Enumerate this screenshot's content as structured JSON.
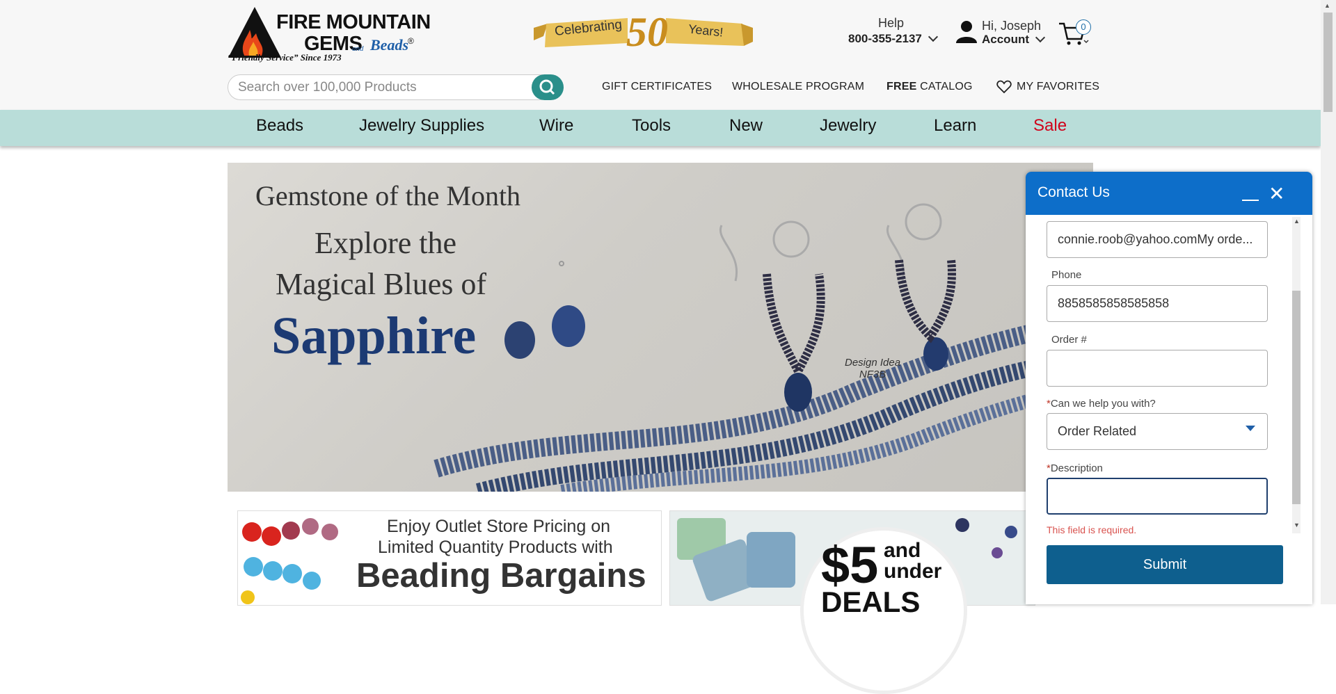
{
  "header": {
    "logo": {
      "line1": "FIRE MOUNTAIN",
      "line2": "GEMS",
      "and": "and",
      "beads": "Beads",
      "reg": "®",
      "tagline": "“Friendly Service” Since 1973"
    },
    "celebrating": {
      "text": "Celebrating",
      "number": "50",
      "years": "Years!"
    },
    "help_label": "Help",
    "phone": "800-355-2137",
    "greeting": "Hi, Joseph",
    "account_label": "Account",
    "cart_count": "0",
    "search_placeholder": "Search over 100,000 Products",
    "links": {
      "gift": "GIFT CERTIFICATES",
      "wholesale": "WHOLESALE PROGRAM",
      "free": "FREE",
      "catalog": "CATALOG",
      "favorites": "MY FAVORITES"
    }
  },
  "menu": [
    "Beads",
    "Jewelry Supplies",
    "Wire",
    "Tools",
    "New",
    "Jewelry",
    "Learn",
    "Sale"
  ],
  "banner": {
    "kicker": "Gemstone of the Month",
    "line1": "Explore the",
    "line2": "Magical Blues of",
    "headline": "Sapphire",
    "design_idea_1": "Design Idea",
    "design_idea_2": "NF3B"
  },
  "tiles": {
    "outlet_line1": "Enjoy Outlet Store Pricing on",
    "outlet_line2": "Limited Quantity Products with",
    "outlet_big": "Beading Bargains",
    "deals_price": "$5",
    "deals_and": "and",
    "deals_under": "under",
    "deals_word": "DEALS"
  },
  "contact": {
    "title": "Contact Us",
    "email_value": "connie.roob@yahoo.comMy orde...",
    "phone_label": "Phone",
    "phone_value": "8858585858585858",
    "order_label": "Order #",
    "order_value": "",
    "help_label": "Can we help you with?",
    "help_value": "Order Related",
    "desc_label": "Description",
    "desc_value": "",
    "error": "This field is required.",
    "submit": "Submit",
    "required_mark": "*"
  },
  "colors": {
    "menu_bg": "#b9ddd9",
    "sale": "#d0021b",
    "widget_header": "#0d6ec9",
    "submit": "#0e5f8e",
    "search_button": "#2a8f8a"
  }
}
